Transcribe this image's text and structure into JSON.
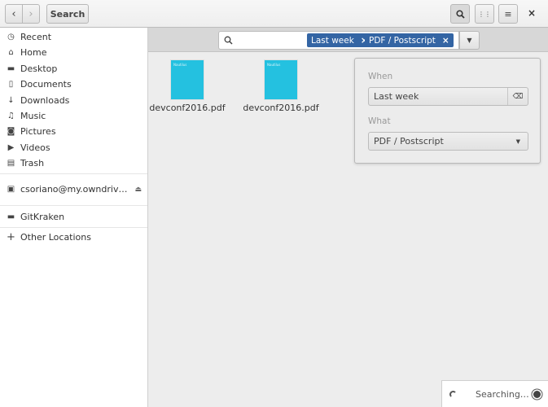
{
  "header": {
    "search_label": "Search",
    "close_icon": "close-icon"
  },
  "sidebar": {
    "items": [
      {
        "label": "Recent",
        "icon": "clock-icon",
        "glyph": "◷"
      },
      {
        "label": "Home",
        "icon": "home-icon",
        "glyph": "⌂"
      },
      {
        "label": "Desktop",
        "icon": "folder-icon",
        "glyph": "▬"
      },
      {
        "label": "Documents",
        "icon": "document-icon",
        "glyph": "▯"
      },
      {
        "label": "Downloads",
        "icon": "download-icon",
        "glyph": "↓"
      },
      {
        "label": "Music",
        "icon": "music-icon",
        "glyph": "♫"
      },
      {
        "label": "Pictures",
        "icon": "camera-icon",
        "glyph": "◙"
      },
      {
        "label": "Videos",
        "icon": "video-icon",
        "glyph": "▶"
      },
      {
        "label": "Trash",
        "icon": "trash-icon",
        "glyph": "▤"
      }
    ],
    "network": {
      "label": "csoriano@my.owndriv…",
      "icon": "network-drive-icon"
    },
    "bookmark": {
      "label": "GitKraken",
      "icon": "folder-icon"
    },
    "other": {
      "label": "Other Locations",
      "icon": "plus-icon"
    }
  },
  "search": {
    "tags": [
      "Last week",
      "PDF / Postscript"
    ]
  },
  "files": [
    {
      "name": "devconf2016.pdf",
      "thumb_title": "Nautilus"
    },
    {
      "name": "devconf2016.pdf",
      "thumb_title": "Nautilus"
    }
  ],
  "popover": {
    "when_label": "When",
    "when_value": "Last week",
    "what_label": "What",
    "what_value": "PDF / Postscript"
  },
  "status": {
    "text": "Searching…"
  },
  "colors": {
    "tag": "#3465a4",
    "thumb": "#24c1e0"
  }
}
